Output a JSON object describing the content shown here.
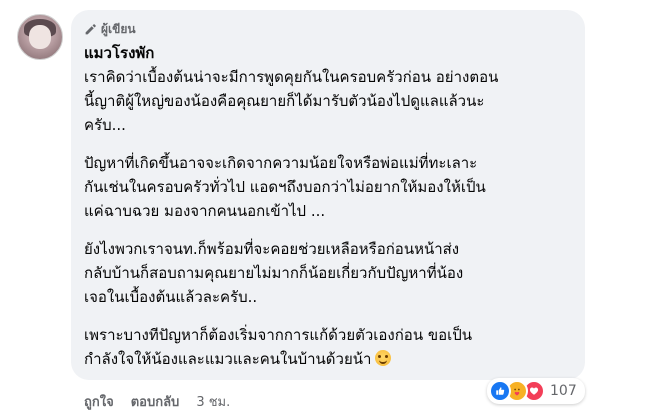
{
  "comment": {
    "author_badge": "ผู้เขียน",
    "author_name": "แมวโรงพัก",
    "paragraphs": [
      [
        "เราคิดว่าเบื้องต้นน่าจะมีการพูดคุยกันในครอบครัวก่อน อย่างตอน",
        "นี้ญาติผู้ใหญ่ของน้องคือคุณยายก็ได้มารับตัวน้องไปดูแลแล้วนะ",
        "ครับ..."
      ],
      [
        "ปัญหาที่เกิดขึ้นอาจจะเกิดจากความน้อยใจหรือพ่อแม่ที่ทะเลาะ",
        "กันเช่นในครอบครัวทั่วไป แอดฯถึงบอกว่าไม่อยากให้มองให้เป็น",
        "แค่ฉาบฉวย มองจากคนนอกเข้าไป ..."
      ],
      [
        "ยังไงพวกเราจนท.ก็พร้อมที่จะคอยช่วยเหลือหรือก่อนหน้าส่ง",
        "กลับบ้านก็สอบถามคุณยายไม่มากก็น้อยเกี่ยวกับปัญหาที่น้อง",
        "เจอในเบื้องต้นแล้วละครับ.."
      ],
      [
        "เพราะบางทีปัญหาก็ต้องเริ่มจากการแก้ด้วยตัวเองก่อน ขอเป็น",
        "กำลังใจให้น้องและแมวและคนในบ้านด้วยน้า"
      ]
    ],
    "emoji_icon": "smiling-face-emoji"
  },
  "reactions": {
    "icons": [
      "like-icon",
      "care-icon",
      "love-icon"
    ],
    "count": "107",
    "colors": {
      "like": "#1877f2",
      "care": "#f7b125",
      "love": "#f33e58"
    }
  },
  "actions": {
    "like_label": "ถูกใจ",
    "reply_label": "ตอบกลับ",
    "time": "3 ชม."
  },
  "colors": {
    "bubble": "#f0f2f5",
    "secondary_text": "#65676b",
    "primary_text": "#050505"
  }
}
